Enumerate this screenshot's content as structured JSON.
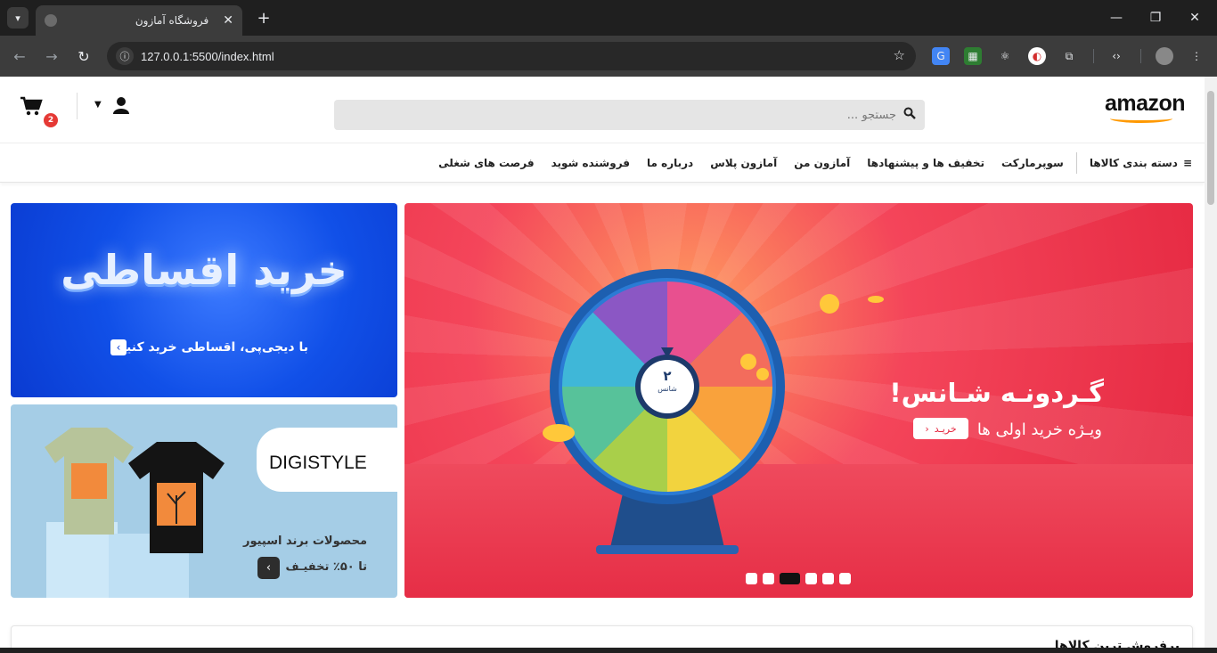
{
  "browser": {
    "tab_title": "فروشگاه آمازون",
    "url": "127.0.0.1:5500/index.html"
  },
  "site": {
    "logo_text": "amazon",
    "search_placeholder": "جستجو ...",
    "cart_count": "2"
  },
  "nav": {
    "categories_label": "دسته بندی کالاها",
    "items": [
      "سوپرمارکت",
      "تخفیف ها و پیشنهادها",
      "آمازون من",
      "آمازون پلاس",
      "درباره ما",
      "فروشنده شوید",
      "فرصت های شغلی"
    ]
  },
  "main_banner": {
    "title": "گـردونـه شـانس!",
    "subtitle": "ویـژه خرید اولی ها",
    "button_label": "خریـد",
    "wheel_center_number": "۲",
    "wheel_center_label": "شانس",
    "slide_count": 6,
    "active_slide": 3
  },
  "banner_installment": {
    "heading": "خرید اقساطی",
    "caption": "با دیجی‌پی، اقساطی خرید کنید!"
  },
  "banner_digistyle": {
    "brand": "DIGISTYLE",
    "line1": "محصولات برند اسپیور",
    "line2": "تا ۵۰٪ تخفیـف"
  },
  "section": {
    "title": "پرفروش ترین کالاها"
  },
  "colors": {
    "brand_orange": "#ff9900",
    "promo_red": "#e4263f",
    "installment_blue": "#1150e8",
    "badge_red": "#e53935"
  }
}
